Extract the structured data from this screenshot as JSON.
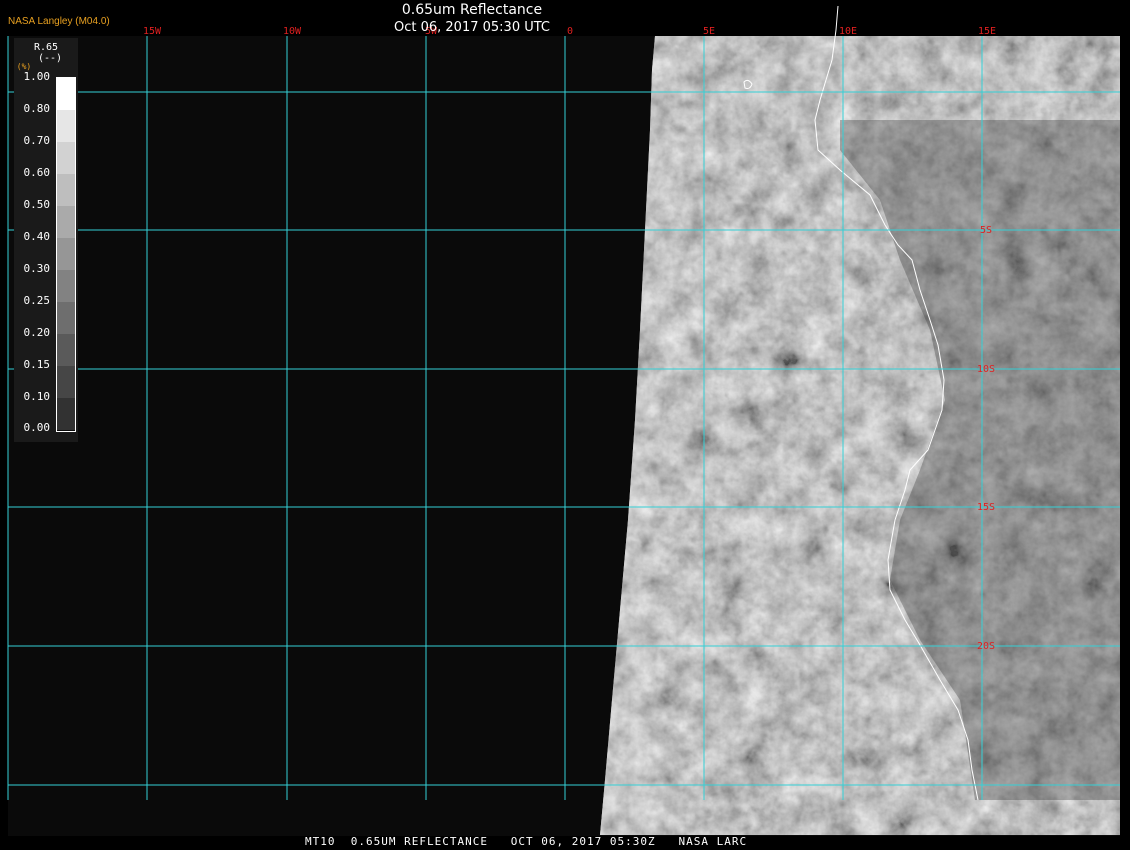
{
  "header": {
    "title": "0.65um Reflectance",
    "subtitle": "Oct 06, 2017 05:30 UTC",
    "org_label": "NASA Langley (M04.0)"
  },
  "footer": {
    "text": "MT10  0.65UM REFLECTANCE   OCT 06, 2017 05:30Z   NASA LARC"
  },
  "legend": {
    "title": "R.65",
    "units": "(--)",
    "unit_letter": "(%)",
    "ticks": [
      "1.00",
      "0.80",
      "0.70",
      "0.60",
      "0.50",
      "0.40",
      "0.30",
      "0.25",
      "0.20",
      "0.15",
      "0.10",
      "0.00"
    ],
    "colors": [
      "#ffffff",
      "#e6e6e6",
      "#d2d2d2",
      "#bebebe",
      "#aaaaaa",
      "#969696",
      "#828282",
      "#6e6e6e",
      "#5a5a5a",
      "#464646",
      "#323232",
      "#0a0a0a"
    ]
  },
  "grid": {
    "longitude_labels": [
      "15W",
      "10W",
      "5W",
      "0",
      "5E",
      "10E",
      "15E"
    ],
    "latitude_labels": [
      "5S",
      "10S",
      "15S",
      "20S"
    ],
    "line_color": "#34d0d6",
    "label_color": "#e02020"
  },
  "map": {
    "background": "#0a0a0a",
    "coastline_color": "#ffffff"
  }
}
